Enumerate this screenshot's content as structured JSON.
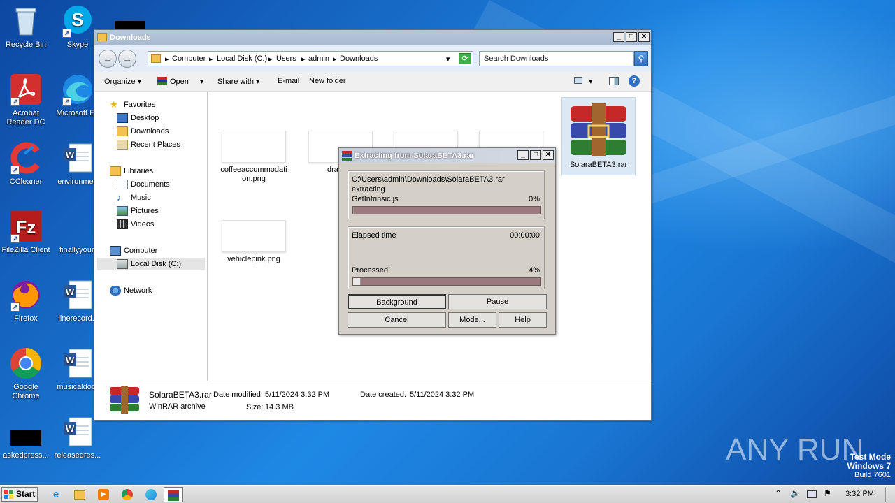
{
  "desktop": {
    "icons": [
      {
        "label": "Recycle Bin"
      },
      {
        "label": "Skype"
      },
      {
        "label": "Acrobat Reader DC"
      },
      {
        "label": "Microsoft Ed"
      },
      {
        "label": "CCleaner"
      },
      {
        "label": "environmen"
      },
      {
        "label": "FileZilla Client"
      },
      {
        "label": "finallyyoun"
      },
      {
        "label": "Firefox"
      },
      {
        "label": "linerecord.r"
      },
      {
        "label": "Google Chrome"
      },
      {
        "label": "musicaldoor"
      },
      {
        "label": "askedpress..."
      },
      {
        "label": "releasedres..."
      }
    ]
  },
  "explorer": {
    "title": "Downloads",
    "breadcrumb": [
      "Computer",
      "Local Disk (C:)",
      "Users",
      "admin",
      "Downloads"
    ],
    "search_placeholder": "Search Downloads",
    "toolbar": {
      "organize": "Organize",
      "open": "Open",
      "share_with": "Share with",
      "email": "E-mail",
      "new_folder": "New folder"
    },
    "nav": {
      "favorites": "Favorites",
      "desktop": "Desktop",
      "downloads": "Downloads",
      "recent_places": "Recent Places",
      "libraries": "Libraries",
      "documents": "Documents",
      "music": "Music",
      "pictures": "Pictures",
      "videos": "Videos",
      "computer": "Computer",
      "local_disk": "Local Disk (C:)",
      "network": "Network"
    },
    "files": [
      {
        "name": "coffeeaccommodation.png"
      },
      {
        "name": "draddre"
      },
      {
        "name": "vehiclepink.png"
      },
      {
        "name": "SolaraBETA3.rar"
      }
    ],
    "details": {
      "filename": "SolaraBETA3.rar",
      "type": "WinRAR archive",
      "modified_label": "Date modified:",
      "modified": "5/11/2024 3:32 PM",
      "created_label": "Date created:",
      "created": "5/11/2024 3:32 PM",
      "size_label": "Size:",
      "size": "14.3 MB"
    }
  },
  "rar_dialog": {
    "title": "Extracting from SolaraBETA3.rar",
    "path": "C:\\Users\\admin\\Downloads\\SolaraBETA3.rar",
    "action": "extracting",
    "current_file": "GetIntrinsic.js",
    "file_percent_text": "0%",
    "file_progress": 0,
    "elapsed_label": "Elapsed time",
    "elapsed": "00:00:00",
    "processed_label": "Processed",
    "processed_percent_text": "4%",
    "processed_progress": 4,
    "buttons": {
      "background": "Background",
      "pause": "Pause",
      "cancel": "Cancel",
      "mode": "Mode...",
      "help": "Help"
    }
  },
  "taskbar": {
    "start": "Start",
    "clock": "3:32 PM"
  },
  "watermark": {
    "brand": "ANY RUN",
    "line1": "Test Mode",
    "line2": "Windows 7",
    "line3": "Build 7601"
  }
}
